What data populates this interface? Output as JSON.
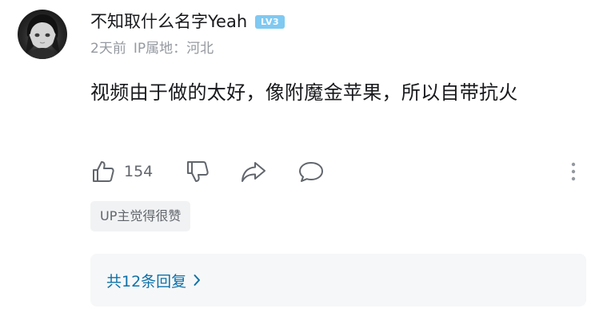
{
  "comment": {
    "user": {
      "name": "不知取什么名字Yeah",
      "level": "LV3",
      "avatar": "anime-girl-avatar"
    },
    "meta": {
      "time": "2天前",
      "ip_location": "IP属地：河北"
    },
    "text": "视频由于做的太好，像附魔金苹果，所以自带抗火",
    "actions": {
      "like_icon": "thumbs-up-icon",
      "like_count": "154",
      "dislike_icon": "thumbs-down-icon",
      "share_icon": "share-icon",
      "reply_icon": "reply-bubble-icon",
      "more_icon": "more-vertical-icon"
    },
    "up_badge": "UP主觉得很赞",
    "replies": {
      "label": "共12条回复",
      "chevron_icon": "chevron-right-icon"
    }
  },
  "colors": {
    "text_primary": "#18191c",
    "text_secondary": "#9499a0",
    "icon": "#61666d",
    "level_badge": "#7fc9f2",
    "reply_link": "#0e71a8",
    "replies_bg": "#f6f7f8",
    "badge_bg": "#f1f2f3"
  }
}
